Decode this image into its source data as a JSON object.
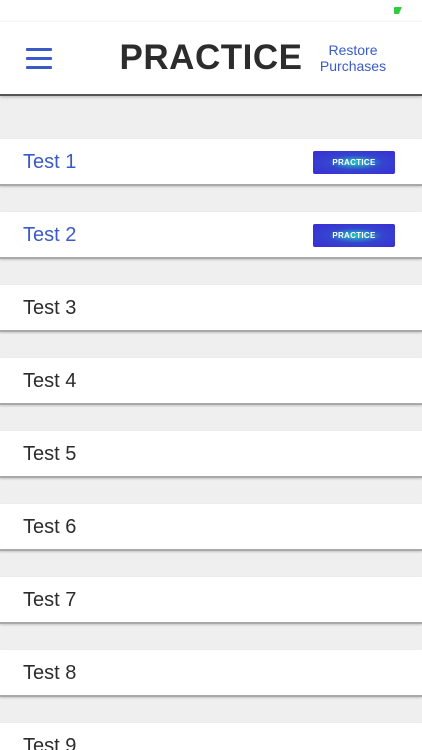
{
  "header": {
    "title": "PRACTICE",
    "restore_line1": "Restore",
    "restore_line2": "Purchases"
  },
  "tests": [
    {
      "label": "Test 1",
      "badge": "PRACTICE"
    },
    {
      "label": "Test 2",
      "badge": "PRACTICE"
    },
    {
      "label": "Test 3"
    },
    {
      "label": "Test 4"
    },
    {
      "label": "Test 5"
    },
    {
      "label": "Test 6"
    },
    {
      "label": "Test 7"
    },
    {
      "label": "Test 8"
    },
    {
      "label": "Test 9"
    }
  ],
  "colors": {
    "accent": "#3a5bc7",
    "badge": "#3a2bd6",
    "status_indicator": "#2ecc40"
  }
}
